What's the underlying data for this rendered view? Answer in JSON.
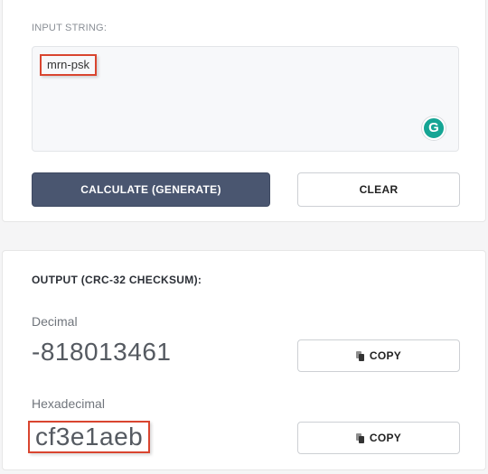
{
  "input_section": {
    "label": "INPUT STRING:",
    "value": "mrn-psk",
    "calculate_label": "CALCULATE (GENERATE)",
    "clear_label": "CLEAR"
  },
  "output_section": {
    "title": "OUTPUT (CRC-32 CHECKSUM):",
    "decimal_label": "Decimal",
    "decimal_value": "-818013461",
    "hex_label": "Hexadecimal",
    "hex_value": "cf3e1aeb",
    "copy_label": "COPY"
  },
  "icons": {
    "grammarly": "grammarly-icon",
    "copy": "copy-icon"
  },
  "colors": {
    "primary_button": "#4a5670",
    "highlight_border": "#d9452f",
    "grammarly": "#15a594"
  }
}
